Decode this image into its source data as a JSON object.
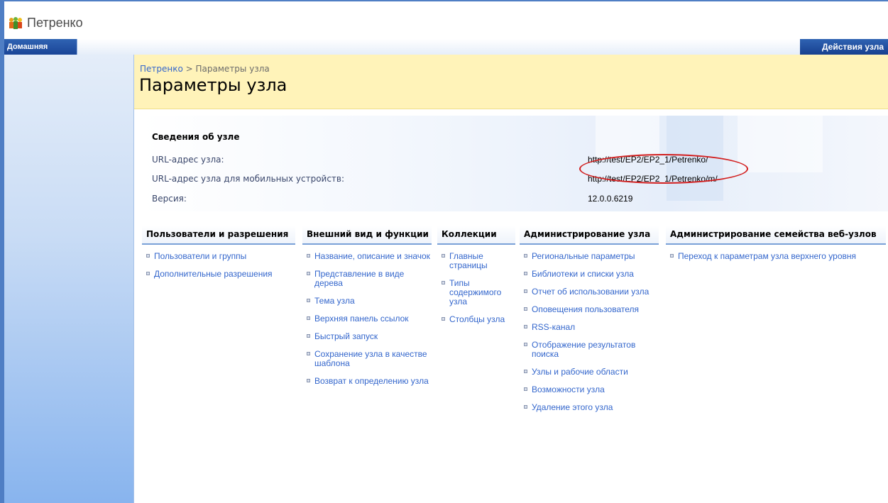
{
  "app": {
    "title": "Петренко"
  },
  "nav": {
    "home_tab": "Домашняя",
    "site_actions": "Действия узла"
  },
  "header": {
    "breadcrumb": {
      "root": "Петренко",
      "separator": " > ",
      "current": "Параметры узла"
    },
    "title": "Параметры узла"
  },
  "site_info": {
    "title": "Сведения об узле",
    "rows": [
      {
        "label": "URL-адрес узла:",
        "value": "http://test/EP2/EP2_1/Petrenko/"
      },
      {
        "label": "URL-адрес узла для мобильных устройств:",
        "value": "http://test/EP2/EP2_1/Petrenko/m/"
      },
      {
        "label": "Версия:",
        "value": "12.0.0.6219"
      }
    ],
    "highlight_color": "#d21e1e"
  },
  "columns": [
    {
      "header": "Пользователи и разрешения",
      "items": [
        "Пользователи и группы",
        "Дополнительные разрешения"
      ]
    },
    {
      "header": "Внешний вид и функции",
      "items": [
        "Название, описание и значок",
        "Представление в виде дерева",
        "Тема узла",
        "Верхняя панель ссылок",
        "Быстрый запуск",
        "Сохранение узла в качестве шаблона",
        "Возврат к определению узла"
      ]
    },
    {
      "header": "Коллекции",
      "items": [
        "Главные страницы",
        "Типы содержимого узла",
        "Столбцы узла"
      ]
    },
    {
      "header": "Администрирование узла",
      "items": [
        "Региональные параметры",
        "Библиотеки и списки узла",
        "Отчет об использовании узла",
        "Оповещения пользователя",
        "RSS-канал",
        "Отображение результатов поиска",
        "Узлы и рабочие области",
        "Возможности узла",
        "Удаление этого узла"
      ]
    },
    {
      "header": "Администрирование семейства веб-узлов",
      "items": [
        "Переход к параметрам узла верхнего уровня"
      ]
    }
  ],
  "colors": {
    "link": "#3366cc",
    "nav_blue": "#1a4597",
    "header_yellow": "#fff3b9"
  }
}
